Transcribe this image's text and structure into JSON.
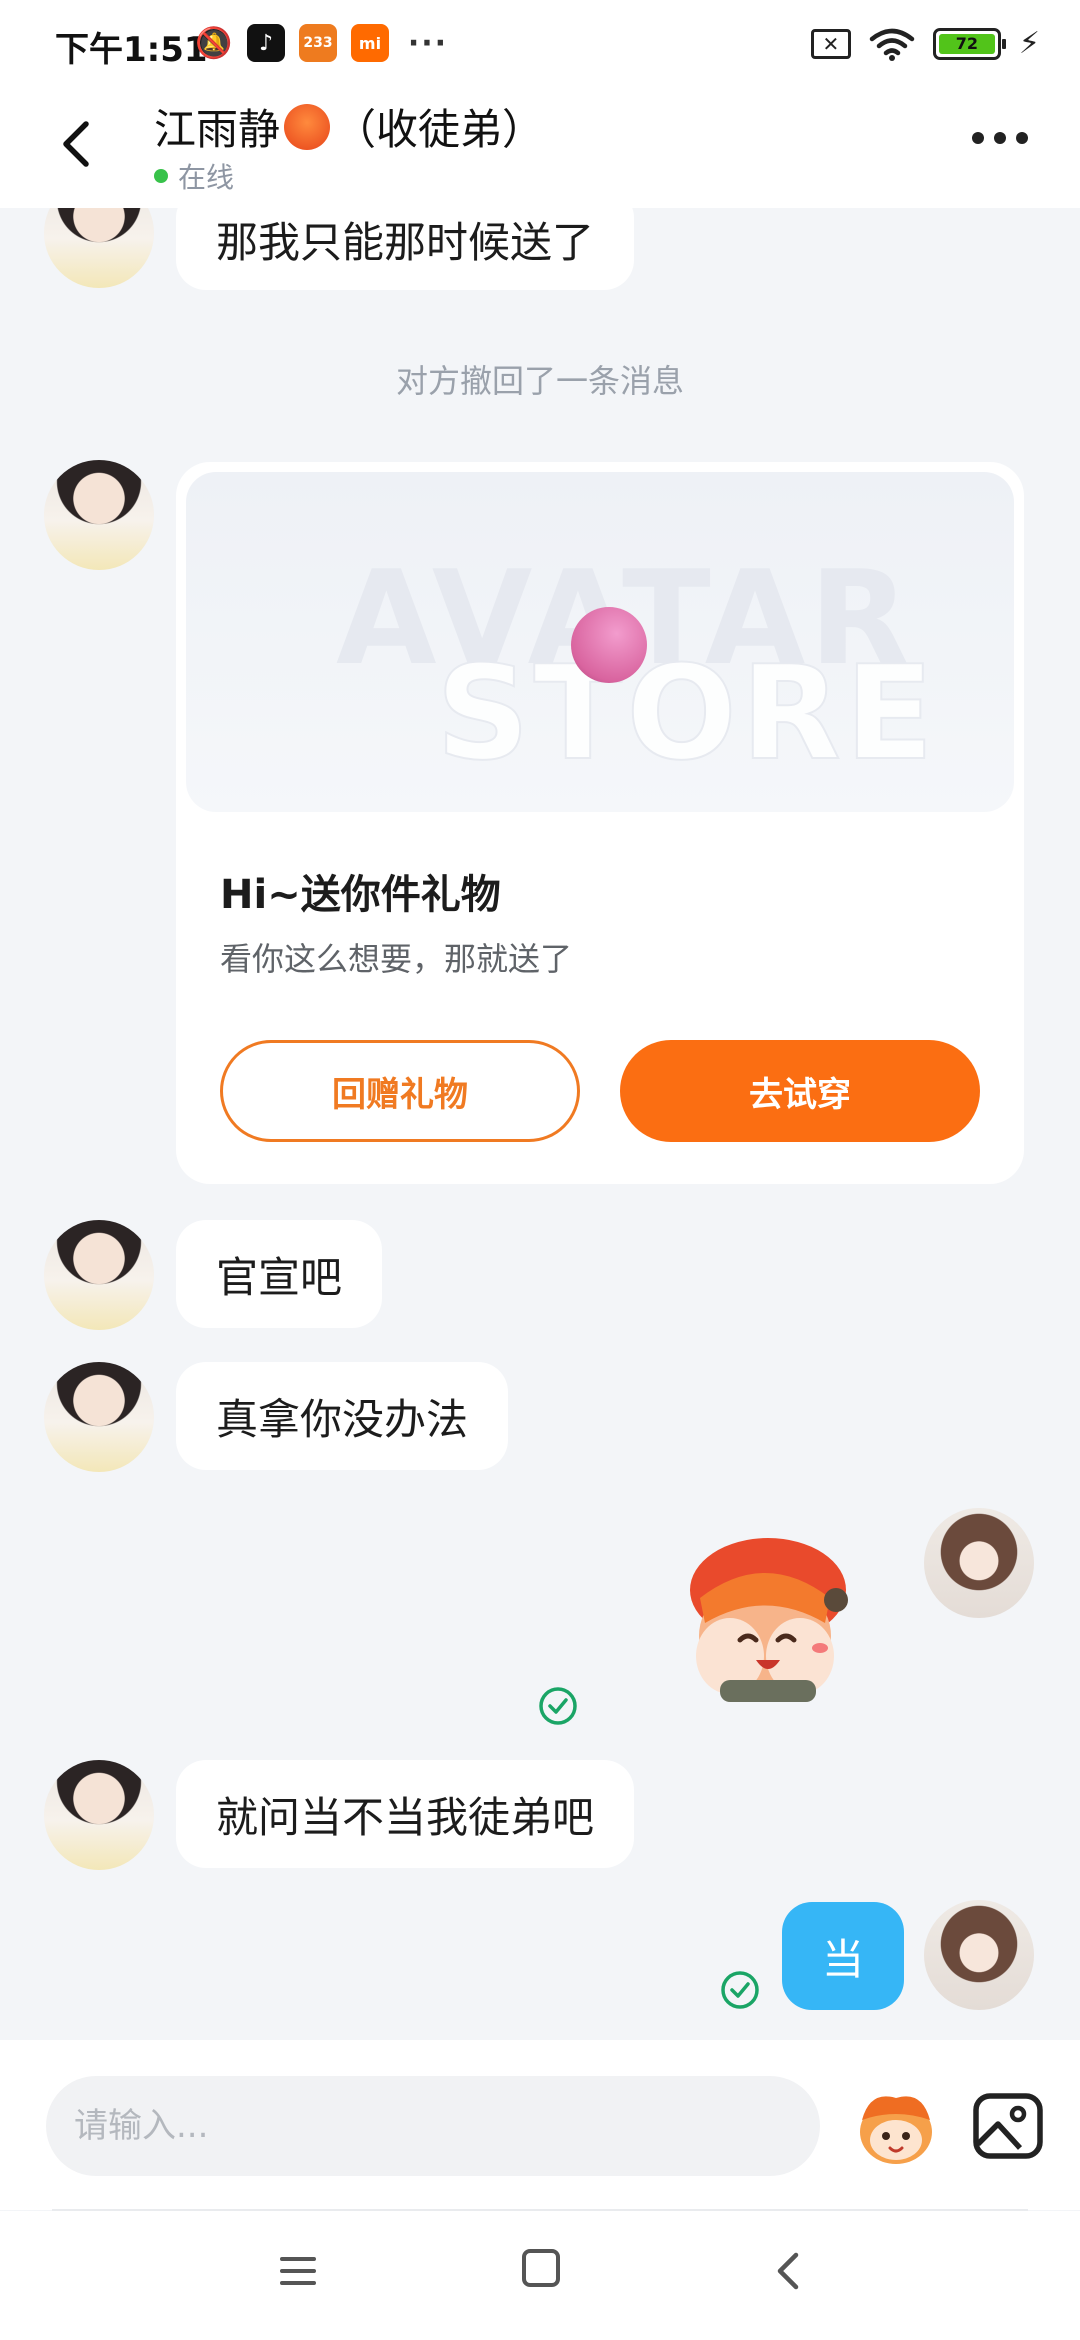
{
  "status_bar": {
    "time": "下午1:51",
    "app_icons": [
      "bell-off-icon",
      "tiktok-icon",
      "233-icon",
      "mi-icon"
    ],
    "app_233": "233",
    "app_mi": "mi",
    "more": "···",
    "battery": "72"
  },
  "header": {
    "title_name": "江雨静",
    "title_suffix": "（收徒弟）",
    "status": "在线"
  },
  "messages": {
    "m1": "那我只能那时候送了",
    "recalled": "对方撤回了一条消息",
    "m2": "官宣吧",
    "m3": "真拿你没办法",
    "m4": "就问当不当我徒弟吧",
    "m5": "当"
  },
  "gift_card": {
    "watermark_line1": "AVATAR",
    "watermark_line2": "STORE",
    "title": "Hi~送你件礼物",
    "description": "看你这么想要，那就送了",
    "return_gift": "回赠礼物",
    "try_on": "去试穿"
  },
  "input": {
    "placeholder": "请输入..."
  },
  "colors": {
    "accent_orange": "#fb6e12",
    "my_bubble": "#36b6f6",
    "read_check": "#1aa566",
    "online": "#38c24a"
  }
}
